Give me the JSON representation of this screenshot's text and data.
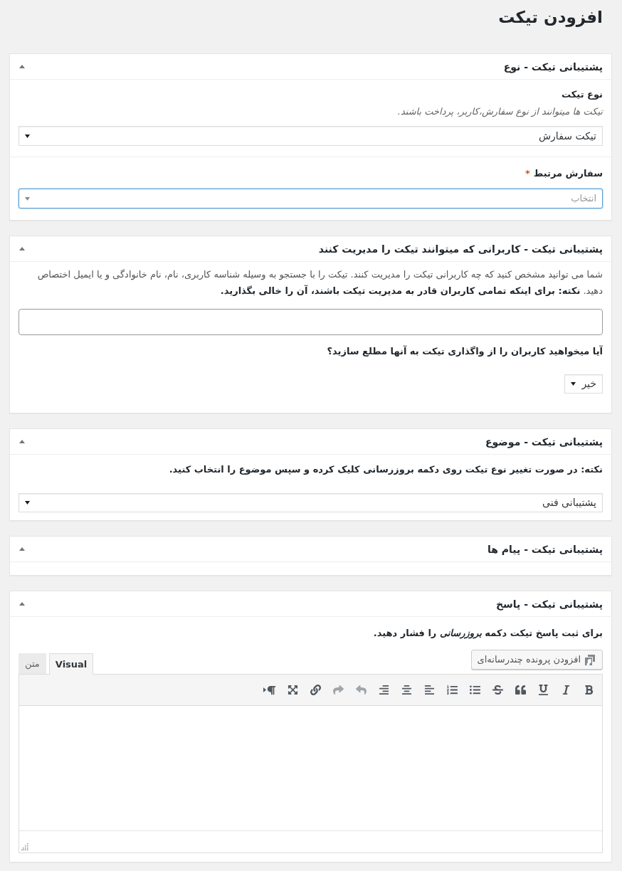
{
  "page_title": "افزودن تیکت",
  "panels": [
    {
      "kind": "ticket_type",
      "title": "پشتیبانی تیکت - نوع",
      "expanded": true,
      "type_field": {
        "label": "نوع تیکت",
        "description": "تیکت ها میتوانند از نوع سفارش،کاربر، پرداخت باشند.",
        "value": "تیکت سفارش"
      },
      "order_field": {
        "label": "سفارش مرتبط",
        "required_mark": "*",
        "placeholder": "انتخاب",
        "focused": true
      }
    },
    {
      "kind": "managers",
      "title": "پشتیبانی تیکت - کاربرانی که میتوانند تیکت را مدیریت کنند",
      "expanded": true,
      "description": "شما می توانید مشخص کنید که چه کاربرانی تیکت را مدیریت کنند. تیکت را با جستجو به وسیله شناسه کاربری، نام، نام خانوادگی و یا ایمیل اختصاص دهید. **نکته: برای اینکه تمامی کاربران قادر به مدیریت تیکت باشند، آن را خالی بگذارید.**",
      "notify_label": "آیا میخواهید کاربران را از واگذاری تیکت به آنها مطلع سازید؟",
      "notify_value": "خیر"
    },
    {
      "kind": "subject",
      "title": "پشتیبانی تیکت - موضوع",
      "expanded": true,
      "note": "نکته: در صورت تغییر نوع تیکت روی دکمه بروزرسانی کلیک کرده و سپس موضوع را انتخاب کنید.",
      "value": "پشتیبانی فنی"
    },
    {
      "kind": "messages",
      "title": "پشتیبانی تیکت - پیام ها",
      "expanded": true
    },
    {
      "kind": "reply",
      "title": "پشتیبانی تیکت - پاسخ",
      "expanded": true,
      "instruction": "برای ثبت پاسخ تیکت دکمه *بروزرسانی* را فشار دهید.",
      "media_button": "افزودن پرونده چندرسانه‌ای",
      "tabs": [
        {
          "label": "Visual",
          "selected": true
        },
        {
          "label": "متن",
          "selected": false
        }
      ],
      "toolbar": [
        {
          "kind": "bold",
          "disabled": false
        },
        {
          "kind": "italic",
          "disabled": false
        },
        {
          "kind": "underline",
          "disabled": false
        },
        {
          "kind": "blockquote",
          "disabled": false
        },
        {
          "kind": "strikethrough",
          "disabled": false
        },
        {
          "kind": "bullet_list",
          "disabled": false
        },
        {
          "kind": "numbered_list",
          "disabled": false
        },
        {
          "kind": "align_left",
          "disabled": false
        },
        {
          "kind": "align_center",
          "disabled": false
        },
        {
          "kind": "align_right",
          "disabled": false
        },
        {
          "kind": "undo",
          "disabled": true
        },
        {
          "kind": "redo",
          "disabled": true
        },
        {
          "kind": "link",
          "disabled": false
        },
        {
          "kind": "fullscreen",
          "disabled": false
        },
        {
          "kind": "rtl",
          "disabled": false
        }
      ]
    }
  ]
}
